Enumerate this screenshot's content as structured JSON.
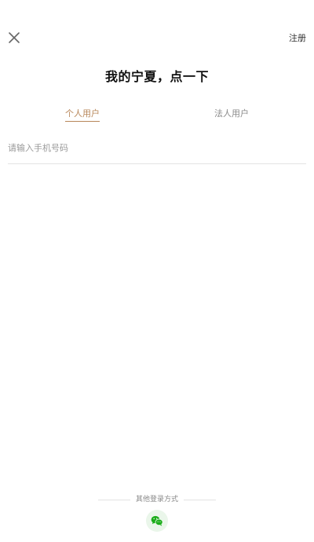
{
  "header": {
    "close_icon": "close-icon",
    "register_label": "注册"
  },
  "title": "我的宁夏，点一下",
  "tabs": [
    {
      "label": "个人用户",
      "active": true
    },
    {
      "label": "法人用户",
      "active": false
    }
  ],
  "phone_input": {
    "placeholder": "请输入手机号码",
    "value": ""
  },
  "other_login": {
    "label": "其他登录方式",
    "methods": [
      {
        "icon": "wechat-icon"
      }
    ]
  },
  "colors": {
    "accent": "#b8875a",
    "wechat_green": "#1aad19",
    "divider": "#e3e3e3"
  }
}
